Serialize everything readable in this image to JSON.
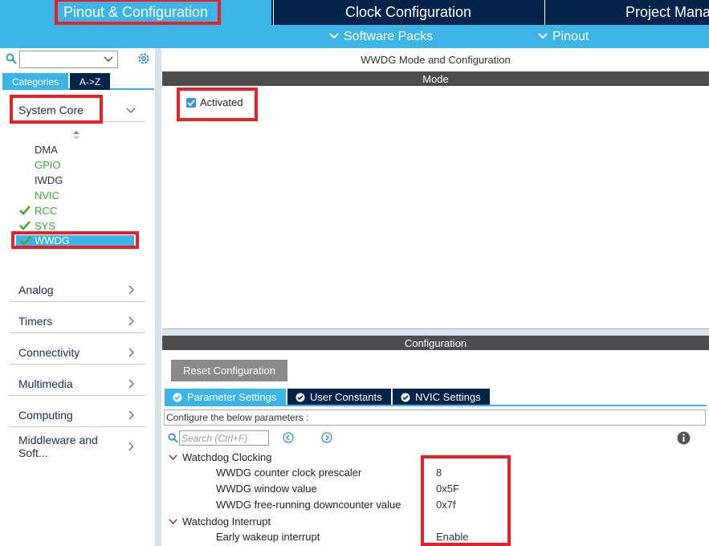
{
  "top_tabs": {
    "pinout": "Pinout & Configuration",
    "clock": "Clock Configuration",
    "project": "Project Manager"
  },
  "sub_menu": {
    "software_packs": "Software Packs",
    "pinout": "Pinout"
  },
  "left": {
    "search_value": "",
    "view_tabs": [
      "Categories",
      "A->Z"
    ],
    "categories": {
      "system_core": "System Core",
      "analog": "Analog",
      "timers": "Timers",
      "connectivity": "Connectivity",
      "multimedia": "Multimedia",
      "computing": "Computing",
      "middleware": "Middleware and Soft..."
    },
    "peripherals": [
      {
        "label": "DMA",
        "checked": false,
        "color": "gray"
      },
      {
        "label": "GPIO",
        "checked": false,
        "color": "green"
      },
      {
        "label": "IWDG",
        "checked": false,
        "color": "gray"
      },
      {
        "label": "NVIC",
        "checked": false,
        "color": "green"
      },
      {
        "label": "RCC",
        "checked": true,
        "color": "green"
      },
      {
        "label": "SYS",
        "checked": true,
        "color": "green"
      },
      {
        "label": "WWDG",
        "checked": true,
        "color": "selected"
      }
    ]
  },
  "main": {
    "mode_title": "WWDG Mode and Configuration",
    "mode_header": "Mode",
    "activated_label": "Activated",
    "config_header": "Configuration",
    "reset_button": "Reset Configuration",
    "param_tabs": [
      "Parameter Settings",
      "User Constants",
      "NVIC Settings"
    ],
    "configure_text": "Configure the below parameters :",
    "search_placeholder": "Search (Ctrl+F)",
    "groups": {
      "clocking": "Watchdog Clocking",
      "interrupt": "Watchdog Interrupt"
    },
    "params": [
      {
        "name": "WWDG counter clock prescaler",
        "value": "8"
      },
      {
        "name": "WWDG window value",
        "value": "0x5F"
      },
      {
        "name": "WWDG free-running downcounter value",
        "value": "0x7f"
      },
      {
        "name": "Early wakeup interrupt",
        "value": "Enable"
      }
    ]
  },
  "colors": {
    "accent": "#3cb4e6",
    "navy": "#03234b",
    "highlight_red": "#e8202a",
    "green": "#3aaa35"
  }
}
